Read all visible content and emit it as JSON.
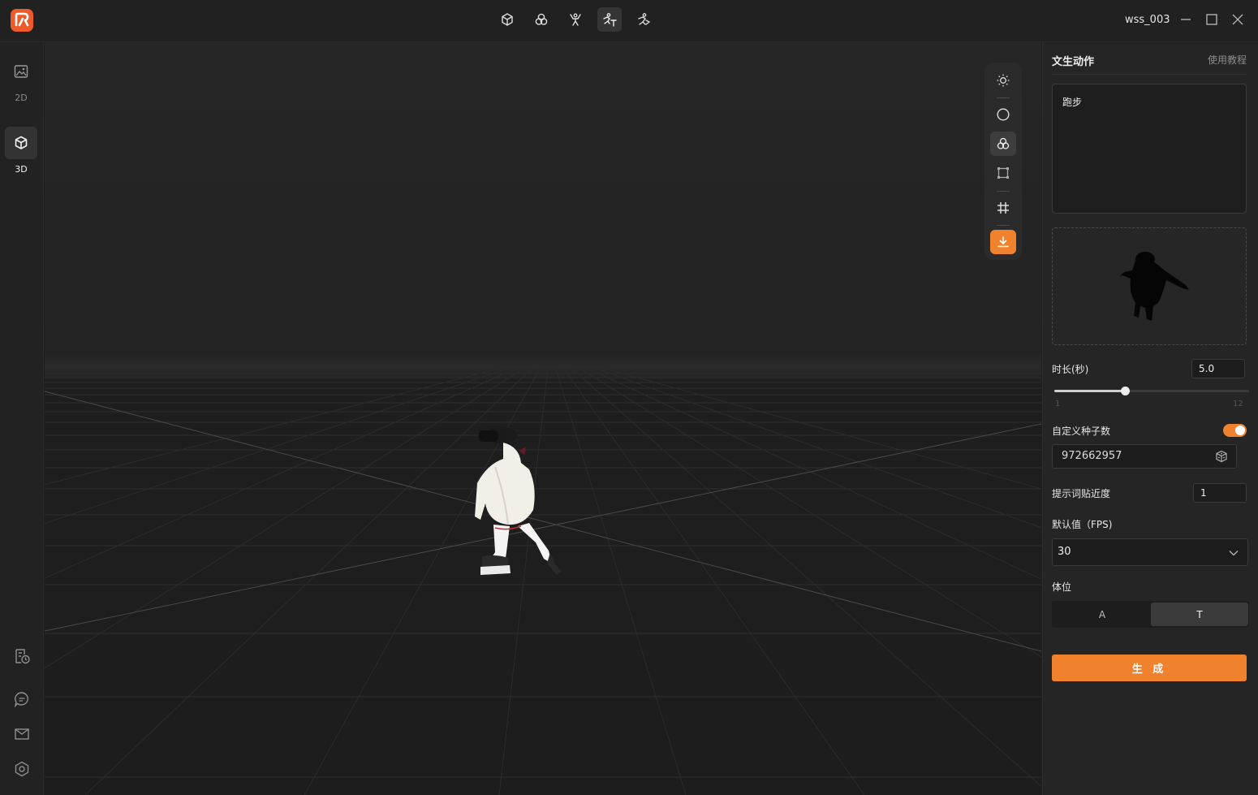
{
  "app": {
    "username": "wss_003",
    "brand_color": "#ef5a2a",
    "accent_color": "#f0822e"
  },
  "topbar": {
    "modes": [
      {
        "icon": "cube-icon"
      },
      {
        "icon": "three-circles-icon"
      },
      {
        "icon": "rig-figure-icon"
      },
      {
        "icon": "text-to-motion-icon",
        "active": true
      },
      {
        "icon": "motion-figure-icon"
      }
    ],
    "window_controls": [
      "minimize-icon",
      "maximize-icon",
      "close-icon"
    ]
  },
  "sidebar": {
    "items": [
      {
        "label": "2D",
        "icon": "image-icon"
      },
      {
        "label": "3D",
        "icon": "cube-icon",
        "active": true
      }
    ],
    "bottom_icons": [
      "history-icon",
      "chat-icon",
      "mail-icon",
      "settings-icon"
    ]
  },
  "viewport_tools": {
    "icons": [
      "light-icon",
      "circle-icon",
      "material-icon",
      "frame-icon",
      "grid-icon",
      "download-icon"
    ],
    "selected": "material-icon"
  },
  "panel": {
    "title": "文生动作",
    "tutorial_link": "使用教程",
    "prompt_text": "跑步",
    "duration": {
      "label": "时长(秒)",
      "value": "5.0",
      "min_label": "1",
      "max_label": "12",
      "min": 1,
      "max": 12,
      "current": 5.0
    },
    "seed": {
      "label": "自定义种子数",
      "enabled": true,
      "value": "972662957"
    },
    "prompt_strength": {
      "label": "提示词贴近度",
      "value": "1"
    },
    "fps": {
      "label": "默认值（FPS)",
      "selected": "30"
    },
    "pose": {
      "label": "体位",
      "options": [
        "A",
        "T"
      ],
      "selected": "T"
    },
    "generate_label": "生 成"
  }
}
